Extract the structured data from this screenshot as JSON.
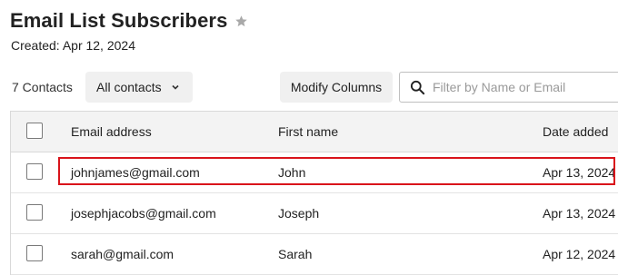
{
  "header": {
    "title": "Email List Subscribers",
    "star_icon": "star-icon",
    "created": "Created: Apr 12, 2024"
  },
  "toolbar": {
    "contact_count": "7 Contacts",
    "filter_label": "All contacts",
    "filter_icon": "chevron-down-icon",
    "modify_columns_label": "Modify Columns",
    "search_placeholder": "Filter by Name or Email",
    "search_value": "",
    "search_icon": "search-icon"
  },
  "table": {
    "columns": [
      "Email address",
      "First name",
      "Date added"
    ],
    "rows": [
      {
        "email": "johnjames@gmail.com",
        "first_name": "John",
        "date_added": "Apr 13, 2024",
        "highlighted": true
      },
      {
        "email": "josephjacobs@gmail.com",
        "first_name": "Joseph",
        "date_added": "Apr 13, 2024",
        "highlighted": false
      },
      {
        "email": "sarah@gmail.com",
        "first_name": "Sarah",
        "date_added": "Apr 12, 2024",
        "highlighted": false
      }
    ]
  },
  "colors": {
    "highlight_border": "#d9141b",
    "button_bg": "#f0f0f0",
    "header_bg": "#f3f3f3"
  }
}
